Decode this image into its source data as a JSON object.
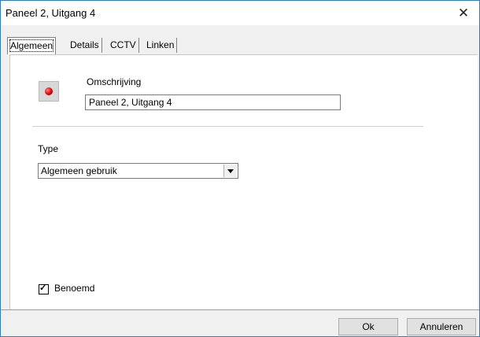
{
  "window": {
    "title": "Paneel 2, Uitgang 4",
    "close_glyph": "✕"
  },
  "tabs": [
    {
      "label": "Algemeen"
    },
    {
      "label": "Details"
    },
    {
      "label": "CCTV"
    },
    {
      "label": "Linken"
    }
  ],
  "status_led": {
    "color": "#e00000",
    "icon": "red-led-icon"
  },
  "description": {
    "label": "Omschrijving",
    "value": "Paneel 2, Uitgang 4"
  },
  "type": {
    "label": "Type",
    "selected": "Algemeen gebruik"
  },
  "named": {
    "label": "Benoemd",
    "checked": true,
    "mark": "✓"
  },
  "buttons": {
    "ok": "Ok",
    "cancel": "Annuleren"
  }
}
